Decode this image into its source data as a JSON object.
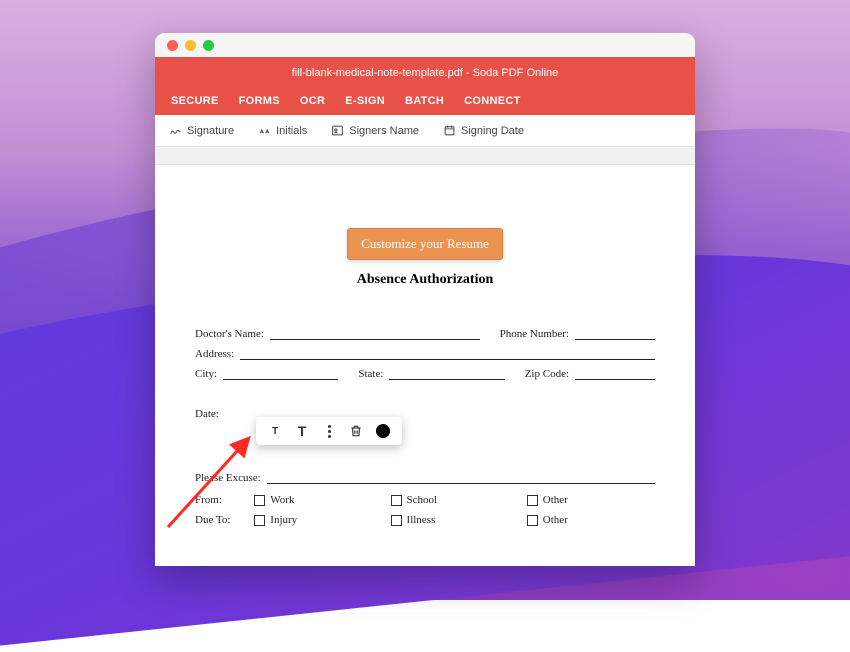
{
  "header": {
    "title": "fill-blank-medical-note-template.pdf - Soda PDF Online",
    "tabs": [
      "SECURE",
      "FORMS",
      "OCR",
      "E-SIGN",
      "BATCH",
      "CONNECT"
    ]
  },
  "toolbar": {
    "signature": "Signature",
    "initials": "Initials",
    "signers_name": "Signers Name",
    "signing_date": "Signing Date"
  },
  "cta": "Customize your Resume",
  "doc_title": "Absence Authorization",
  "fields": {
    "doctors_name": "Doctor's Name:",
    "phone": "Phone Number:",
    "address": "Address:",
    "city": "City:",
    "state": "State:",
    "zip": "Zip Code:",
    "date": "Date:",
    "please_excuse": "Please Excuse:",
    "from": "From:",
    "due_to": "Due To:"
  },
  "from_opts": [
    "Work",
    "School",
    "Other"
  ],
  "due_opts": [
    "Injury",
    "Illness",
    "Other"
  ],
  "mini_toolbar": {
    "icons": [
      "text-small-icon",
      "text-large-icon",
      "more-icon",
      "trash-icon",
      "color-icon"
    ]
  }
}
